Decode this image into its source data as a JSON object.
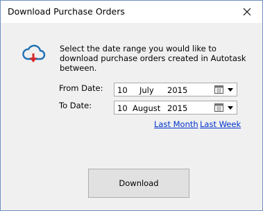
{
  "window": {
    "title": "Download Purchase Orders"
  },
  "icons": {
    "cloud": "cloud-download-icon",
    "close": "close-icon",
    "calendar": "calendar-icon",
    "dropdown": "chevron-down-icon"
  },
  "colors": {
    "cloud_outline": "#1f6fb5",
    "cloud_arrow": "#d62b2b",
    "link": "#0033cc",
    "button_bg": "#e1e1e1"
  },
  "message": "Select the date range you would like to download purchase orders created in Autotask between.",
  "from_date": {
    "label": "From Date:",
    "day": "10",
    "month": "July",
    "year": "2015"
  },
  "to_date": {
    "label": "To Date:",
    "day": "10",
    "month": "August",
    "year": "2015"
  },
  "links": {
    "last_month": "Last Month",
    "last_week": "Last Week"
  },
  "download_button": "Download"
}
